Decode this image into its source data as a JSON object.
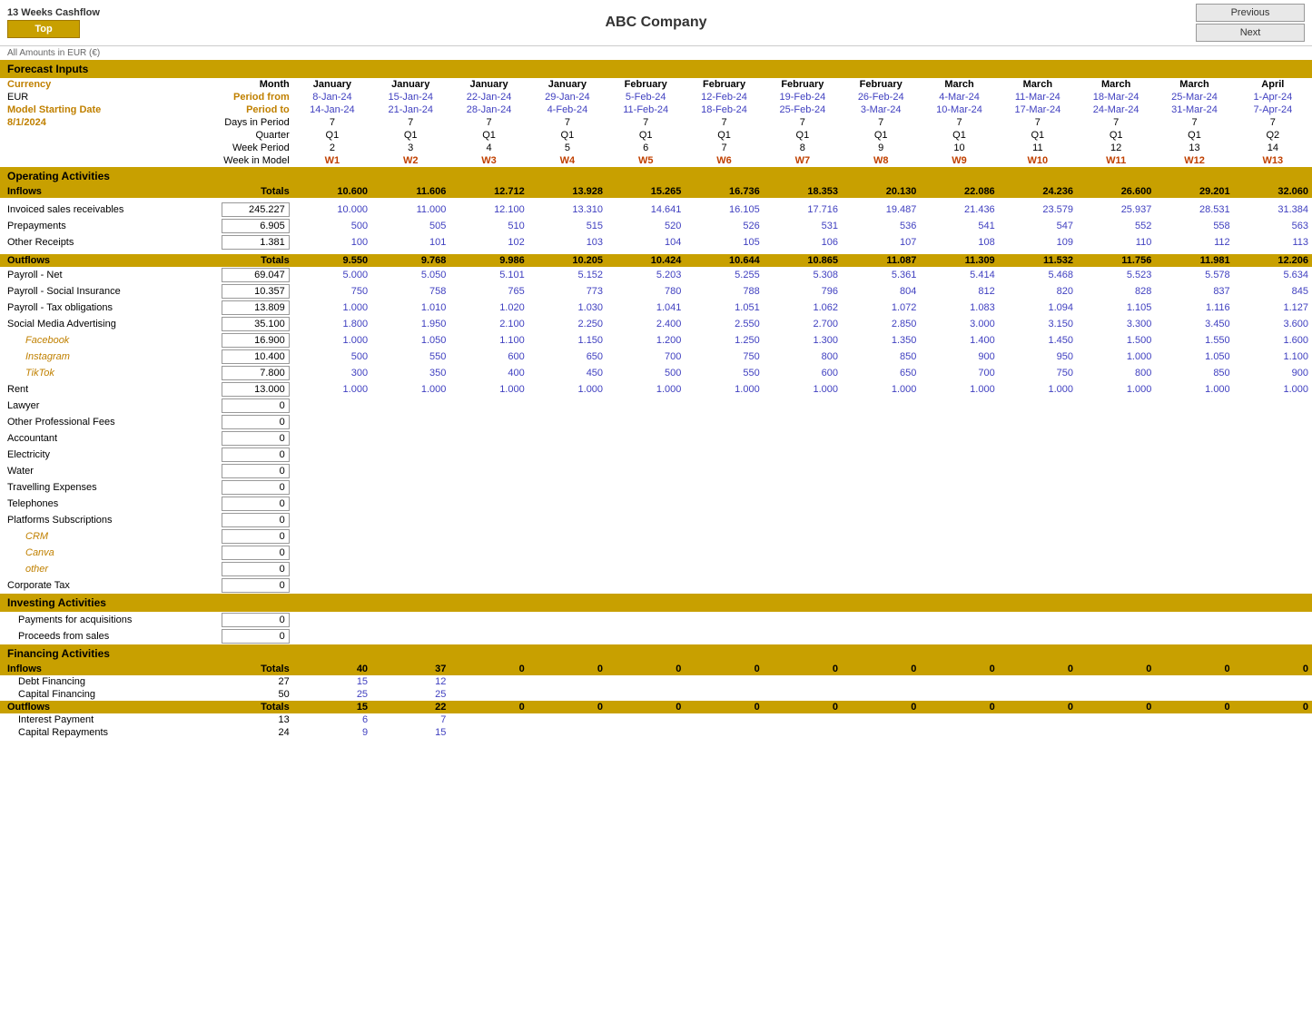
{
  "app": {
    "title": "13 Weeks Cashflow",
    "top_button": "Top",
    "previous_button": "Previous",
    "next_button": "Next",
    "company": "ABC Company",
    "currency_note": "All Amounts in EUR (€)"
  },
  "header_rows": {
    "currency_label": "Currency",
    "currency_val": "EUR",
    "model_start_label": "Model Starting Date",
    "model_start_val": "8/1/2024",
    "month_label": "Month",
    "period_from_label": "Period from",
    "period_to_label": "Period to",
    "days_label": "Days in Period",
    "quarter_label": "Quarter",
    "week_period_label": "Week Period",
    "week_model_label": "Week in Model",
    "columns": [
      {
        "month": "January",
        "from": "8-Jan-24",
        "to": "14-Jan-24",
        "days": "7",
        "quarter": "Q1",
        "week_period": "2",
        "week_model": "W1"
      },
      {
        "month": "January",
        "from": "15-Jan-24",
        "to": "21-Jan-24",
        "days": "7",
        "quarter": "Q1",
        "week_period": "3",
        "week_model": "W2"
      },
      {
        "month": "January",
        "from": "22-Jan-24",
        "to": "28-Jan-24",
        "days": "7",
        "quarter": "Q1",
        "week_period": "4",
        "week_model": "W3"
      },
      {
        "month": "January",
        "from": "29-Jan-24",
        "to": "4-Feb-24",
        "days": "7",
        "quarter": "Q1",
        "week_period": "5",
        "week_model": "W4"
      },
      {
        "month": "February",
        "from": "5-Feb-24",
        "to": "11-Feb-24",
        "days": "7",
        "quarter": "Q1",
        "week_period": "6",
        "week_model": "W5"
      },
      {
        "month": "February",
        "from": "12-Feb-24",
        "to": "18-Feb-24",
        "days": "7",
        "quarter": "Q1",
        "week_period": "7",
        "week_model": "W6"
      },
      {
        "month": "February",
        "from": "19-Feb-24",
        "to": "25-Feb-24",
        "days": "7",
        "quarter": "Q1",
        "week_period": "8",
        "week_model": "W7"
      },
      {
        "month": "February",
        "from": "26-Feb-24",
        "to": "3-Mar-24",
        "days": "7",
        "quarter": "Q1",
        "week_period": "9",
        "week_model": "W8"
      },
      {
        "month": "March",
        "from": "4-Mar-24",
        "to": "10-Mar-24",
        "days": "7",
        "quarter": "Q1",
        "week_period": "10",
        "week_model": "W9"
      },
      {
        "month": "March",
        "from": "11-Mar-24",
        "to": "17-Mar-24",
        "days": "7",
        "quarter": "Q1",
        "week_period": "11",
        "week_model": "W10"
      },
      {
        "month": "March",
        "from": "18-Mar-24",
        "to": "24-Mar-24",
        "days": "7",
        "quarter": "Q1",
        "week_period": "12",
        "week_model": "W11"
      },
      {
        "month": "March",
        "from": "25-Mar-24",
        "to": "31-Mar-24",
        "days": "7",
        "quarter": "Q1",
        "week_period": "13",
        "week_model": "W12"
      },
      {
        "month": "April",
        "from": "1-Apr-24",
        "to": "7-Apr-24",
        "days": "7",
        "quarter": "Q2",
        "week_period": "14",
        "week_model": "W13"
      }
    ]
  },
  "sections": {
    "forecast_inputs": "Forecast Inputs",
    "operating_activities": "Operating Activities",
    "investing_activities": "Investing Activities",
    "financing_activities": "Financing Activities"
  },
  "inflows": {
    "label": "Inflows",
    "totals_label": "Totals",
    "total": "10.600",
    "values": [
      "11.606",
      "12.712",
      "13.928",
      "15.265",
      "16.736",
      "18.353",
      "20.130",
      "22.086",
      "24.236",
      "26.600",
      "29.201",
      "32.060"
    ],
    "rows": [
      {
        "label": "Invoiced sales receivables",
        "total": "245.227",
        "values": [
          "10.000",
          "11.000",
          "12.100",
          "13.310",
          "14.641",
          "16.105",
          "17.716",
          "19.487",
          "21.436",
          "23.579",
          "25.937",
          "28.531",
          "31.384"
        ]
      },
      {
        "label": "Prepayments",
        "total": "6.905",
        "values": [
          "500",
          "505",
          "510",
          "515",
          "520",
          "526",
          "531",
          "536",
          "541",
          "547",
          "552",
          "558",
          "563"
        ]
      },
      {
        "label": "Other Receipts",
        "total": "1.381",
        "values": [
          "100",
          "101",
          "102",
          "103",
          "104",
          "105",
          "106",
          "107",
          "108",
          "109",
          "110",
          "112",
          "113"
        ]
      }
    ]
  },
  "outflows": {
    "label": "Outflows",
    "totals_label": "Totals",
    "total": "9.550",
    "values": [
      "9.768",
      "9.986",
      "10.205",
      "10.424",
      "10.644",
      "10.865",
      "11.087",
      "11.309",
      "11.532",
      "11.756",
      "11.981",
      "12.206"
    ],
    "rows": [
      {
        "label": "Payroll - Net",
        "total": "69.047",
        "values": [
          "5.000",
          "5.050",
          "5.101",
          "5.152",
          "5.203",
          "5.255",
          "5.308",
          "5.361",
          "5.414",
          "5.468",
          "5.523",
          "5.578",
          "5.634"
        ]
      },
      {
        "label": "Payroll - Social Insurance",
        "total": "10.357",
        "values": [
          "750",
          "758",
          "765",
          "773",
          "780",
          "788",
          "796",
          "804",
          "812",
          "820",
          "828",
          "837",
          "845"
        ]
      },
      {
        "label": "Payroll - Tax obligations",
        "total": "13.809",
        "values": [
          "1.000",
          "1.010",
          "1.020",
          "1.030",
          "1.041",
          "1.051",
          "1.062",
          "1.072",
          "1.083",
          "1.094",
          "1.105",
          "1.116",
          "1.127"
        ]
      },
      {
        "label": "Social Media Advertising",
        "total": "35.100",
        "values": [
          "1.800",
          "1.950",
          "2.100",
          "2.250",
          "2.400",
          "2.550",
          "2.700",
          "2.850",
          "3.000",
          "3.150",
          "3.300",
          "3.450",
          "3.600"
        ]
      },
      {
        "label": "Facebook",
        "italic": true,
        "total": "16.900",
        "values": [
          "1.000",
          "1.050",
          "1.100",
          "1.150",
          "1.200",
          "1.250",
          "1.300",
          "1.350",
          "1.400",
          "1.450",
          "1.500",
          "1.550",
          "1.600"
        ]
      },
      {
        "label": "Instagram",
        "italic": true,
        "total": "10.400",
        "values": [
          "500",
          "550",
          "600",
          "650",
          "700",
          "750",
          "800",
          "850",
          "900",
          "950",
          "1.000",
          "1.050",
          "1.100"
        ]
      },
      {
        "label": "TikTok",
        "italic": true,
        "total": "7.800",
        "values": [
          "300",
          "350",
          "400",
          "450",
          "500",
          "550",
          "600",
          "650",
          "700",
          "750",
          "800",
          "850",
          "900"
        ]
      },
      {
        "label": "Rent",
        "total": "13.000",
        "values": [
          "1.000",
          "1.000",
          "1.000",
          "1.000",
          "1.000",
          "1.000",
          "1.000",
          "1.000",
          "1.000",
          "1.000",
          "1.000",
          "1.000",
          "1.000"
        ]
      },
      {
        "label": "Lawyer",
        "total": "0",
        "values": []
      },
      {
        "label": "Other Professional Fees",
        "total": "0",
        "values": []
      },
      {
        "label": "Accountant",
        "total": "0",
        "values": []
      },
      {
        "label": "Electricity",
        "total": "0",
        "values": []
      },
      {
        "label": "Water",
        "total": "0",
        "values": []
      },
      {
        "label": "Travelling Expenses",
        "total": "0",
        "values": []
      },
      {
        "label": "Telephones",
        "total": "0",
        "values": []
      },
      {
        "label": "Platforms Subscriptions",
        "total": "0",
        "values": []
      },
      {
        "label": "CRM",
        "italic": true,
        "total": "0",
        "values": []
      },
      {
        "label": "Canva",
        "italic": true,
        "total": "0",
        "values": []
      },
      {
        "label": "other",
        "italic": true,
        "total": "0",
        "values": []
      },
      {
        "label": "Corporate Tax",
        "total": "0",
        "values": []
      }
    ]
  },
  "investing": {
    "rows": [
      {
        "label": "Payments for acquisitions",
        "total": "0",
        "values": []
      },
      {
        "label": "Proceeds from sales",
        "total": "0",
        "values": []
      }
    ]
  },
  "financing_inflows": {
    "label": "Inflows",
    "totals_label": "Totals",
    "total": "40",
    "values": [
      "37",
      "0",
      "0",
      "0",
      "0",
      "0",
      "0",
      "0",
      "0",
      "0",
      "0",
      "0"
    ],
    "rows": [
      {
        "label": "Debt Financing",
        "total": "27",
        "values": [
          "15",
          "12",
          "",
          "",
          "",
          "",
          "",
          "",
          "",
          "",
          "",
          "",
          ""
        ]
      },
      {
        "label": "Capital Financing",
        "total": "50",
        "values": [
          "25",
          "25",
          "",
          "",
          "",
          "",
          "",
          "",
          "",
          "",
          "",
          "",
          ""
        ]
      }
    ]
  },
  "financing_outflows": {
    "label": "Outflows",
    "totals_label": "Totals",
    "total": "15",
    "values": [
      "22",
      "0",
      "0",
      "0",
      "0",
      "0",
      "0",
      "0",
      "0",
      "0",
      "0",
      "0"
    ],
    "rows": [
      {
        "label": "Interest Payment",
        "total": "13",
        "values": [
          "6",
          "7",
          "",
          "",
          "",
          "",
          "",
          "",
          "",
          "",
          "",
          "",
          ""
        ]
      },
      {
        "label": "Capital Repayments",
        "total": "24",
        "values": [
          "9",
          "15",
          "",
          "",
          "",
          "",
          "",
          "",
          "",
          "",
          "",
          "",
          ""
        ]
      }
    ]
  }
}
